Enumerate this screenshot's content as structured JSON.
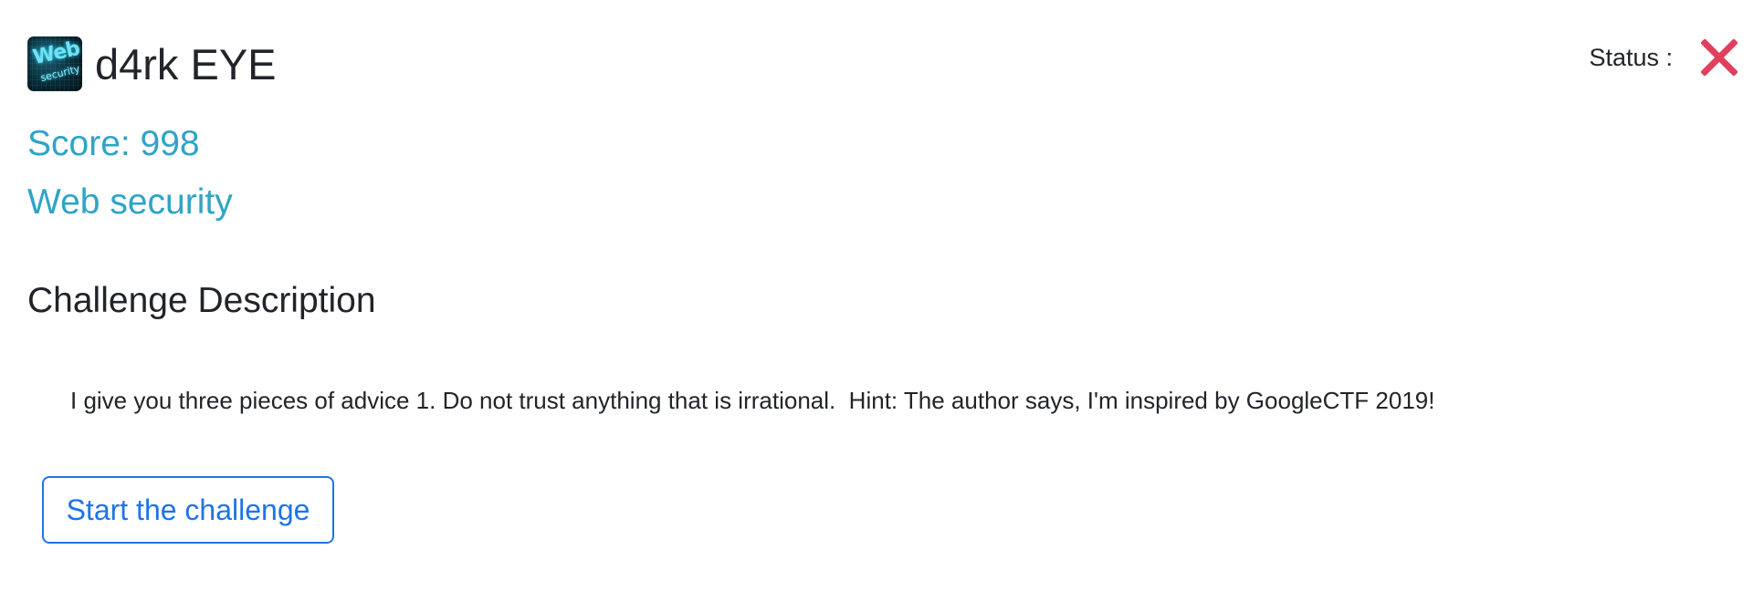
{
  "challenge": {
    "logo_icon": "web-security-logo",
    "logo_text": "Web",
    "logo_subtext": "security",
    "title": "d4rk EYE",
    "score_text": "Score: 998",
    "category": "Web security"
  },
  "status": {
    "label": "Status :",
    "icon": "close-icon",
    "state": "unsolved",
    "color": "#e0405e"
  },
  "description": {
    "heading": "Challenge Description",
    "text": "I give you three pieces of advice 1. Do not trust anything that is irrational.  Hint: The author says, I'm inspired by GoogleCTF 2019!"
  },
  "actions": {
    "start_label": "Start the challenge"
  },
  "colors": {
    "accent": "#2fa4c6",
    "button": "#1f74e6"
  }
}
